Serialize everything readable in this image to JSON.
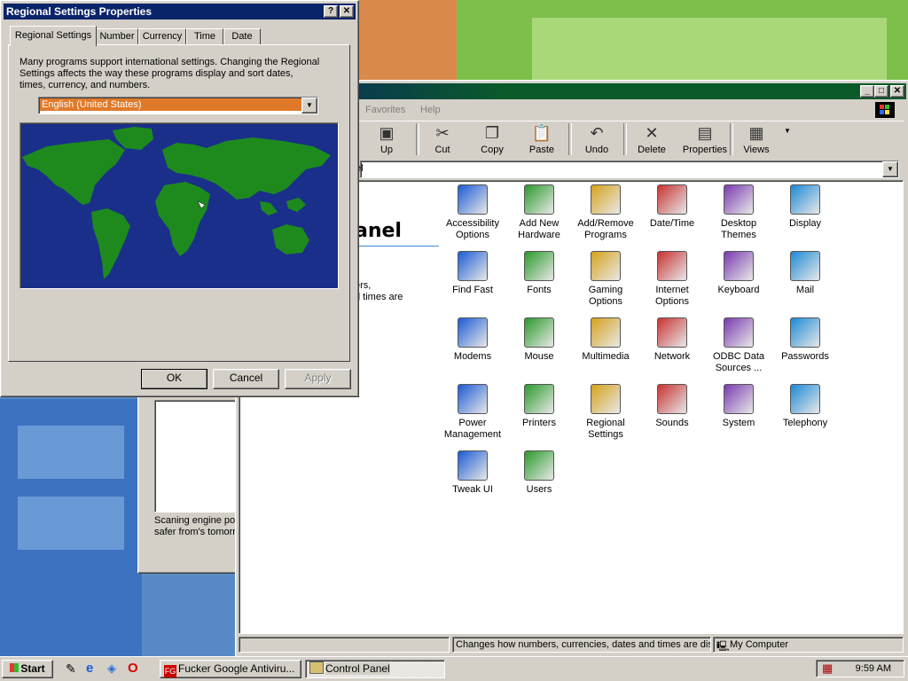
{
  "colors": {
    "title_active": "#0a246a",
    "desktop": "#5a8ac6",
    "map_sea": "#1a2f8a",
    "map_land": "#1e8a1e",
    "select_bg": "#e07a2a"
  },
  "regional_dialog": {
    "title": "Regional Settings Properties",
    "help_btn": "?",
    "close_btn": "✕",
    "tabs": [
      "Regional Settings",
      "Number",
      "Currency",
      "Time",
      "Date"
    ],
    "description": "Many programs support international settings. Changing the Regional Settings affects the way these programs display and sort dates, times, currency, and numbers.",
    "locale_value": "English (United States)",
    "ok": "OK",
    "cancel": "Cancel",
    "apply": "Apply"
  },
  "antivirus_window": {
    "line1": "Scaning engine pou",
    "line2": "safer from's tomorro"
  },
  "control_panel": {
    "menu": [
      "Favorites",
      "Help"
    ],
    "toolbar": [
      {
        "label": "Up",
        "icon": "up-folder-icon"
      },
      {
        "label": "Cut",
        "icon": "scissors-icon"
      },
      {
        "label": "Copy",
        "icon": "copy-icon"
      },
      {
        "label": "Paste",
        "icon": "paste-icon"
      },
      {
        "label": "Undo",
        "icon": "undo-icon"
      },
      {
        "label": "Delete",
        "icon": "delete-icon"
      },
      {
        "label": "Properties",
        "icon": "properties-icon"
      },
      {
        "label": "Views",
        "icon": "views-icon"
      }
    ],
    "address_value": "el",
    "heading": "anel",
    "side_text1": "ers,",
    "side_text2": "d times are",
    "icons": [
      {
        "label": "Accessibility Options",
        "icon": "accessibility-icon"
      },
      {
        "label": "Add New Hardware",
        "icon": "add-hardware-icon"
      },
      {
        "label": "Add/Remove Programs",
        "icon": "add-remove-programs-icon"
      },
      {
        "label": "Date/Time",
        "icon": "date-time-icon"
      },
      {
        "label": "Desktop Themes",
        "icon": "desktop-themes-icon"
      },
      {
        "label": "Display",
        "icon": "display-icon"
      },
      {
        "label": "Find Fast",
        "icon": "find-fast-icon"
      },
      {
        "label": "Fonts",
        "icon": "fonts-icon"
      },
      {
        "label": "Gaming Options",
        "icon": "gaming-options-icon"
      },
      {
        "label": "Internet Options",
        "icon": "internet-options-icon"
      },
      {
        "label": "Keyboard",
        "icon": "keyboard-icon"
      },
      {
        "label": "Mail",
        "icon": "mail-icon"
      },
      {
        "label": "Modems",
        "icon": "modems-icon"
      },
      {
        "label": "Mouse",
        "icon": "mouse-icon"
      },
      {
        "label": "Multimedia",
        "icon": "multimedia-icon"
      },
      {
        "label": "Network",
        "icon": "network-icon"
      },
      {
        "label": "ODBC Data Sources ...",
        "icon": "odbc-icon"
      },
      {
        "label": "Passwords",
        "icon": "passwords-icon"
      },
      {
        "label": "Power Management",
        "icon": "power-management-icon"
      },
      {
        "label": "Printers",
        "icon": "printers-icon"
      },
      {
        "label": "Regional Settings",
        "icon": "regional-settings-icon"
      },
      {
        "label": "Sounds",
        "icon": "sounds-icon"
      },
      {
        "label": "System",
        "icon": "system-icon"
      },
      {
        "label": "Telephony",
        "icon": "telephony-icon"
      },
      {
        "label": "Tweak UI",
        "icon": "tweak-ui-icon"
      },
      {
        "label": "Users",
        "icon": "users-icon"
      }
    ],
    "status_text": "Changes how numbers, currencies, dates and times are disp",
    "status_zone": "My Computer"
  },
  "taskbar": {
    "start": "Start",
    "tasks": [
      {
        "label": "Fucker Google Antiviru...",
        "icon": "antivirus-app-icon"
      },
      {
        "label": "Control Panel",
        "icon": "control-panel-icon"
      }
    ],
    "clock": "9:59 AM"
  }
}
